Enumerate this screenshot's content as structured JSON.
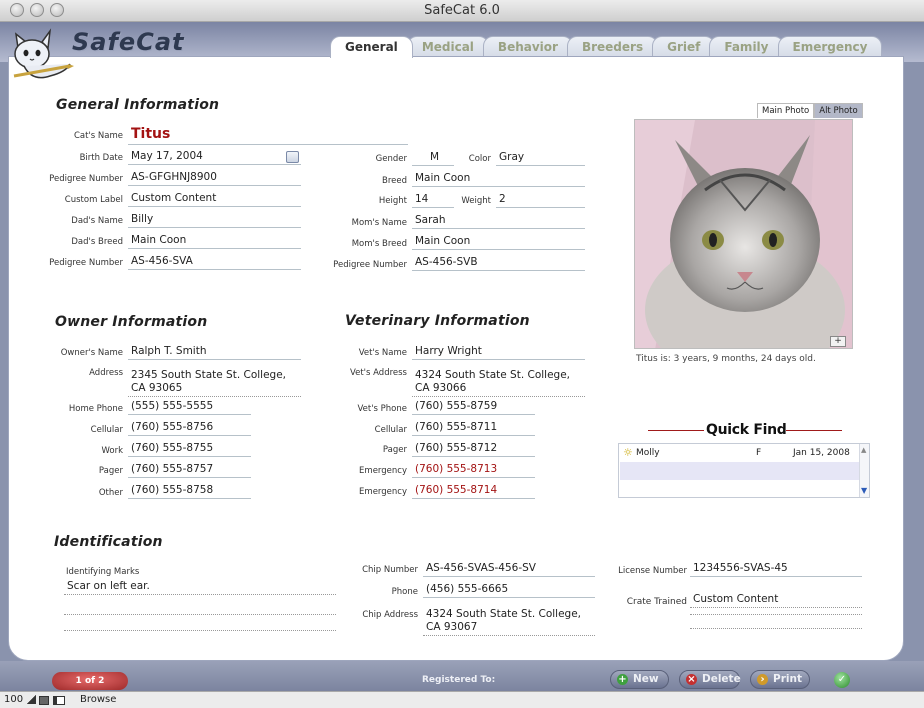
{
  "window": {
    "title": "SafeCat 6.0"
  },
  "app": {
    "logo_text": "SafeCat"
  },
  "tabs": [
    "General",
    "Medical",
    "Behavior",
    "Breeders",
    "Grief",
    "Family",
    "Emergency"
  ],
  "general": {
    "title": "General Information",
    "cats_name_label": "Cat's Name",
    "cats_name": "Titus",
    "birth_date_label": "Birth Date",
    "birth_date": "May 17, 2004",
    "pedigree_label": "Pedigree Number",
    "pedigree": "AS-GFGHNJ8900",
    "custom_label": "Custom  Label",
    "custom_value": "Custom Content",
    "dads_name_label": "Dad's Name",
    "dads_name": "Billy",
    "dads_breed_label": "Dad's Breed",
    "dads_breed": "Main Coon",
    "dad_pedigree_label": "Pedigree Number",
    "dad_pedigree": "AS-456-SVA",
    "gender_label": "Gender",
    "gender": "M",
    "color_label": "Color",
    "color": "Gray",
    "breed_label": "Breed",
    "breed": "Main Coon",
    "height_label": "Height",
    "height": "14",
    "weight_label": "Weight",
    "weight": "2",
    "moms_name_label": "Mom's Name",
    "moms_name": "Sarah",
    "moms_breed_label": "Mom's Breed",
    "moms_breed": "Main Coon",
    "mom_pedigree_label": "Pedigree Number",
    "mom_pedigree": "AS-456-SVB"
  },
  "photo": {
    "main_tab": "Main Photo",
    "alt_tab": "Alt Photo",
    "add": "+",
    "age_text": "Titus is: 3 years, 9 months, 24 days old."
  },
  "owner": {
    "title": "Owner Information",
    "name_label": "Owner's Name",
    "name": "Ralph T. Smith",
    "address_label": "Address",
    "address": "2345 South State St. College, CA 93065",
    "home_label": "Home Phone",
    "home": "(555) 555-5555",
    "cell_label": "Cellular",
    "cell": "(760) 555-8756",
    "work_label": "Work",
    "work": "(760) 555-8755",
    "pager_label": "Pager",
    "pager": "(760) 555-8757",
    "other_label": "Other",
    "other": "(760) 555-8758"
  },
  "vet": {
    "title": "Veterinary Information",
    "name_label": "Vet's Name",
    "name": "Harry Wright",
    "address_label": "Vet's Address",
    "address": "4324 South State St. College, CA 93066",
    "phone_label": "Vet's Phone",
    "phone": "(760) 555-8759",
    "cell_label": "Cellular",
    "cell": "(760) 555-8711",
    "pager_label": "Pager",
    "pager": "(760) 555-8712",
    "emergency_label": "Emergency",
    "emergency1": "(760) 555-8713",
    "emergency2": "(760) 555-8714"
  },
  "quickfind": {
    "title": "Quick Find",
    "rows": [
      {
        "name": "Molly",
        "sex": "F",
        "date": "Jan 15, 2008"
      }
    ]
  },
  "identification": {
    "title": "Identification",
    "marks_label": "Identifying Marks",
    "marks": "Scar on left ear.",
    "chip_number_label": "Chip Number",
    "chip_number": "AS-456-SVAS-456-SV",
    "phone_label": "Phone",
    "phone": "(456) 555-6665",
    "chip_address_label": "Chip Address",
    "chip_address": "4324 South State St. College, CA 93067",
    "license_label": "License Number",
    "license": "1234556-SVAS-45",
    "crate_label": "Crate Trained",
    "crate": "Custom Content"
  },
  "bottom": {
    "pager": "1 of 2",
    "registered": "Registered To:",
    "new": "New",
    "delete": "Delete",
    "print": "Print"
  },
  "status": {
    "zoom": "100",
    "mode": "Browse"
  }
}
